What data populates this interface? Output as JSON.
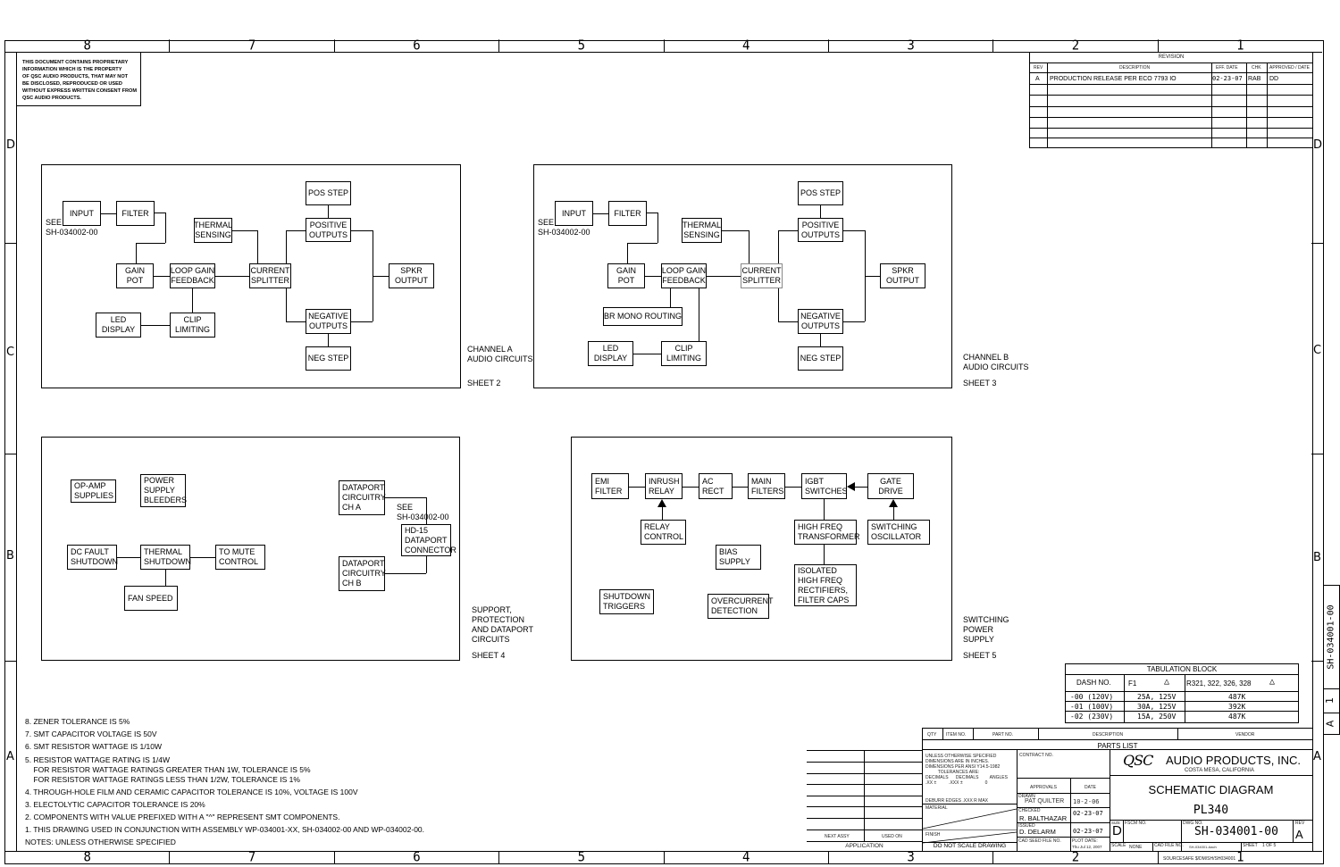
{
  "document": {
    "title": "SCHEMATIC DIAGRAM",
    "model": "PL340",
    "drawing_number": "SH-034001-00",
    "revision": "A",
    "size": "D",
    "scale": "NONE",
    "cad_file": "SH-034001-Aach",
    "sheet": "1 OF 5",
    "sourcesafe": "SOURCESAFE $/DM/SH/SH034001"
  },
  "zones": {
    "columns": [
      "8",
      "7",
      "6",
      "5",
      "4",
      "3",
      "2",
      "1"
    ],
    "rows": [
      "D",
      "C",
      "B",
      "A"
    ]
  },
  "proprietary_notice": "THIS DOCUMENT CONTAINS PROPRIETARY\nINFORMATION WHICH IS THE PROPERTY\nOF QSC AUDIO PRODUCTS, THAT MAY NOT\nBE DISCLOSED, REPRODUCED OR USED\nWITHOUT EXPRESS WRITTEN CONSENT FROM\nQSC AUDIO PRODUCTS.",
  "revision_block": {
    "title": "REVISION",
    "headers": [
      "REV",
      "DESCRIPTION",
      "EFF. DATE",
      "CHK",
      "APPROVED / DATE"
    ],
    "rows": [
      {
        "rev": "A",
        "description": "PRODUCTION RELEASE PER ECO 7793 IO",
        "eff_date": "02-23-07",
        "chk": "RAB",
        "approved": "DD"
      }
    ]
  },
  "panels": {
    "channel_a": {
      "caption": "CHANNEL A\nAUDIO CIRCUITS",
      "sheet": "SHEET 2",
      "see_ref": "SEE\nSH-034002-00",
      "blocks": {
        "input": "INPUT",
        "filter": "FILTER",
        "thermal": "THERMAL\nSENSING",
        "pos_step": "POS STEP",
        "pos_out": "POSITIVE\nOUTPUTS",
        "gain_pot": "GAIN\nPOT",
        "loop_gain": "LOOP GAIN\nFEEDBACK",
        "current_splitter": "CURRENT\nSPLITTER",
        "spkr": "SPKR\nOUTPUT",
        "led": "LED\nDISPLAY",
        "clip": "CLIP\nLIMITING",
        "neg_out": "NEGATIVE\nOUTPUTS",
        "neg_step": "NEG STEP"
      }
    },
    "channel_b": {
      "caption": "CHANNEL B\nAUDIO CIRCUITS",
      "sheet": "SHEET 3",
      "see_ref": "SEE\nSH-034002-00",
      "blocks": {
        "input": "INPUT",
        "filter": "FILTER",
        "thermal": "THERMAL\nSENSING",
        "pos_step": "POS STEP",
        "pos_out": "POSITIVE\nOUTPUTS",
        "gain_pot": "GAIN\nPOT",
        "loop_gain": "LOOP GAIN\nFEEDBACK",
        "current_splitter": "CURRENT\nSPLITTER",
        "spkr": "SPKR\nOUTPUT",
        "br_mono": "BR MONO ROUTING",
        "led": "LED\nDISPLAY",
        "clip": "CLIP\nLIMITING",
        "neg_out": "NEGATIVE\nOUTPUTS",
        "neg_step": "NEG STEP"
      }
    },
    "support": {
      "caption": "SUPPORT,\nPROTECTION\nAND DATAPORT\nCIRCUITS",
      "sheet": "SHEET 4",
      "see_ref": "SEE\nSH-034002-00",
      "blocks": {
        "opamp": "OP-AMP\nSUPPLIES",
        "bleeders": "POWER\nSUPPLY\nBLEEDERS",
        "dc_fault": "DC FAULT\nSHUTDOWN",
        "thermal_sd": "THERMAL\nSHUTDOWN",
        "mute": "TO MUTE\nCONTROL",
        "fan": "FAN SPEED",
        "dp_a": "DATAPORT\nCIRCUITRY\nCH A",
        "dp_b": "DATAPORT\nCIRCUITRY\nCH B",
        "hd15": "HD-15\nDATAPORT\nCONNECTOR"
      }
    },
    "smps": {
      "caption": "SWITCHING\nPOWER\nSUPPLY",
      "sheet": "SHEET 5",
      "blocks": {
        "emi": "EMI\nFILTER",
        "inrush": "INRUSH\nRELAY",
        "ac_rect": "AC\nRECT",
        "main_filters": "MAIN\nFILTERS",
        "igbt": "IGBT\nSWITCHES",
        "gate": "GATE\nDRIVE",
        "relay_ctrl": "RELAY\nCONTROL",
        "hf_xfmr": "HIGH FREQ\nTRANSFORMER",
        "osc": "SWITCHING\nOSCILLATOR",
        "bias": "BIAS\nSUPPLY",
        "isolated": "ISOLATED\nHIGH FREQ\nRECTIFIERS,\nFILTER CAPS",
        "shutdown": "SHUTDOWN\nTRIGGERS",
        "overcurrent": "OVERCURRENT\nDETECTION"
      }
    }
  },
  "tabulation_block": {
    "title": "TABULATION BLOCK",
    "headers": [
      "DASH NO.",
      "F1",
      "R321, 322, 326, 328"
    ],
    "header_flags": [
      "",
      "1",
      "2"
    ],
    "rows": [
      [
        "-00 (120V)",
        "25A, 125V",
        "487K"
      ],
      [
        "-01 (100V)",
        "30A, 125V",
        "392K"
      ],
      [
        "-02 (230V)",
        "15A, 250V",
        "487K"
      ]
    ]
  },
  "side_tab": {
    "dwg_label": "DWG NO.",
    "dwg": "SH-034001-00",
    "sheet_label": "SH",
    "sheet": "1",
    "rev_label": "REV",
    "rev": "A"
  },
  "notes": {
    "heading": "NOTES: UNLESS OTHERWISE SPECIFIED",
    "items": [
      "8. ZENER TOLERANCE IS 5%",
      "7. SMT CAPACITOR VOLTAGE IS 50V",
      "6. SMT RESISTOR WATTAGE IS 1/10W",
      "5. RESISTOR WATTAGE RATING IS 1/4W",
      "    FOR RESISTOR WATTAGE RATINGS GREATER THAN 1W, TOLERANCE IS 5%",
      "    FOR RESISTOR WATTAGE RATINGS LESS THAN 1/2W, TOLERANCE IS 1%",
      "4. THROUGH-HOLE FILM AND CERAMIC CAPACITOR TOLERANCE IS 10%, VOLTAGE IS 100V",
      "3. ELECTOLYTIC CAPACITOR TOLERANCE IS 20%",
      "2. COMPONENTS WITH VALUE PREFIXED WITH A \"^\" REPRESENT SMT COMPONENTS.",
      "1. THIS DRAWING USED IN CONJUNCTION WITH ASSEMBLY WP-034001-XX, SH-034002-00 AND WP-034002-00."
    ]
  },
  "parts_list": {
    "title": "PARTS LIST",
    "headers": [
      "QTY",
      "ITEM NO.",
      "PART NO.",
      "DESCRIPTION",
      "VENDOR"
    ]
  },
  "application": {
    "title": "APPLICATION",
    "next_assy": "NEXT ASSY",
    "used_on": "USED ON"
  },
  "title_block": {
    "tolerances": "UNLESS OTHERWISE SPECIFIED\nDIMENSIONS ARE IN INCHES.\nDIMENSIONS PER ANSI Y14.5-1982\n          TOLERANCES ARE:\nDECIMALS      DECIMALS         ANGLES\n.XX ±          .XXX ±                  0",
    "deburr": "DEBURR EDGES .XXX R MAX",
    "material": "MATERIAL",
    "finish": "FINISH",
    "do_not_scale": "DO NOT SCALE DRAWING",
    "contract": "CONTRACT NO.",
    "approvals": "APPROVALS",
    "date": "DATE",
    "drawn_label": "DRAWN",
    "drawn_by": "PAT QUILTER",
    "drawn_date": "10-2-06",
    "checked_label": "CHECKED",
    "checked_by": "R. BALTHAZAR",
    "checked_date": "02-23-07",
    "issued_label": "ISSUED",
    "issued_by": "D. DELARM",
    "issued_date": "02-23-07",
    "cad_seed": "CAD SEED FILE NO.",
    "plot_date_label": "PLOT DATE:",
    "plot_date": "Thu Jul 12, 2007",
    "company": "AUDIO PRODUCTS, INC.",
    "logo": "QSC",
    "location": "COSTA MESA, CALIFORNIA",
    "size_label": "SIZE",
    "fscm_label": "FSCM NO.",
    "dwg_label": "DWG NO.",
    "rev_label": "REV",
    "scale_label": "SCALE",
    "cad_file_label": "CAD FILE NO.",
    "sheet_label": "SHEET"
  }
}
